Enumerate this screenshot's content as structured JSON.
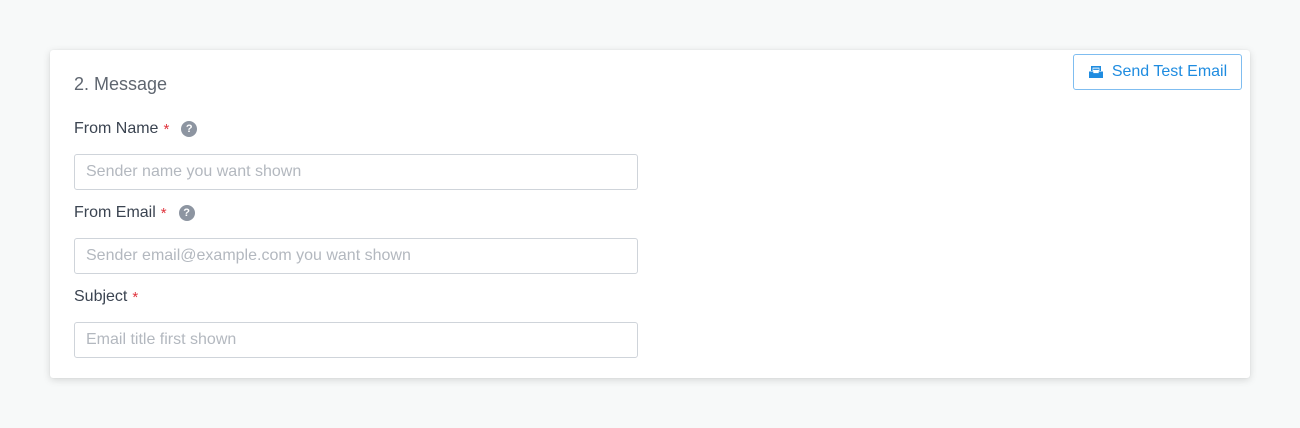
{
  "section": {
    "title": "2. Message",
    "test_button_label": "Send Test Email"
  },
  "fields": [
    {
      "label": "From Name",
      "required_marker": "*",
      "help": "?",
      "value": "",
      "placeholder": "Sender name you want shown"
    },
    {
      "label": "From Email",
      "required_marker": "*",
      "help": "?",
      "value": "",
      "placeholder": "Sender email@example.com you want shown"
    },
    {
      "label": "Subject",
      "required_marker": "*",
      "value": "",
      "placeholder": "Email title first shown"
    }
  ],
  "colors": {
    "accent": "#1f8ce0",
    "required": "#e0343d",
    "help_icon": "#8d95a1"
  }
}
